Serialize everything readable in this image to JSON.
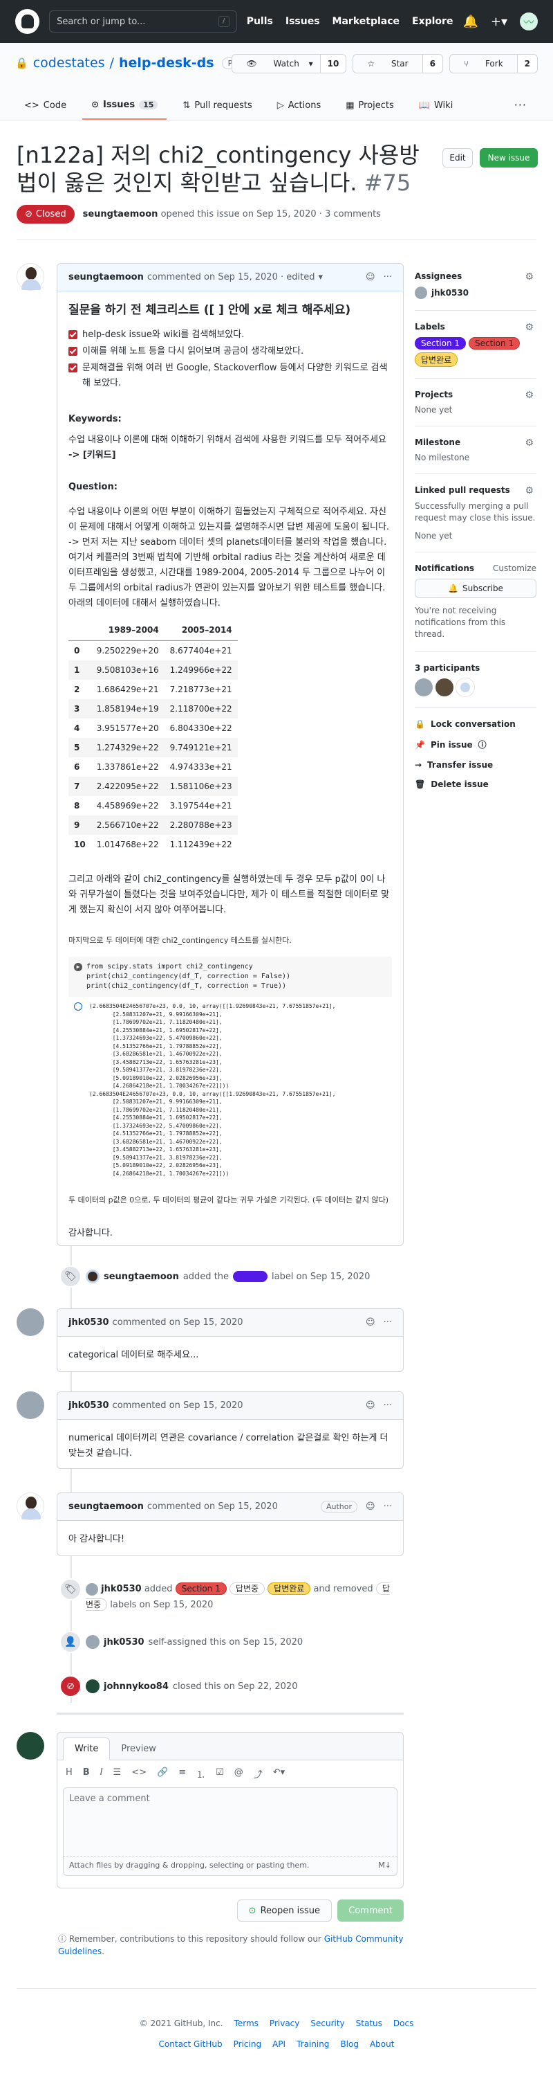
{
  "header": {
    "search_placeholder": "Search or jump to...",
    "slash": "/",
    "nav": [
      "Pulls",
      "Issues",
      "Marketplace",
      "Explore"
    ]
  },
  "repo": {
    "owner": "codestates",
    "name": "help-desk-ds",
    "visibility": "Private",
    "watch": "Watch",
    "watch_count": "10",
    "star": "Star",
    "star_count": "6",
    "fork": "Fork",
    "fork_count": "2"
  },
  "tabs": [
    {
      "label": "Code"
    },
    {
      "label": "Issues",
      "count": "15"
    },
    {
      "label": "Pull requests"
    },
    {
      "label": "Actions"
    },
    {
      "label": "Projects"
    },
    {
      "label": "Wiki"
    }
  ],
  "issue": {
    "title": "[n122a] 저의 chi2_contingency 사용방법이 옳은 것인지 확인받고 싶습니다.",
    "number": "#75",
    "edit": "Edit",
    "new_issue": "New issue",
    "state": "Closed",
    "author": "seungtaemoon",
    "meta": "opened this issue on Sep 15, 2020 · 3 comments"
  },
  "first_comment": {
    "author": "seungtaemoon",
    "meta": "commented on Sep 15, 2020 · edited",
    "heading": "질문을 하기 전 체크리스트 ([ ] 안에 x로 체크 해주세요)",
    "checks": [
      "help-desk issue와 wiki를 검색해보았다.",
      "이해를 위해 노트 등을 다시 읽어보며 공금이 생각해보았다.",
      "문제해결을 위해 여러 번 Google, Stackoverflow 등에서 다양한 키워드로 검색해 보았다."
    ],
    "kw_title": "Keywords:",
    "kw_text": "수업 내용이나 이론에 대해 이해하기 위해서 검색에 사용한 키워드를 모두 적어주세요",
    "kw_value": "-> [키워드]",
    "q_title": "Question:",
    "q_text": "수업 내용이나 이론의 어떤 부분이 이해하기 힘들었는지 구체적으로 적어주세요. 자신이 문제에 대해서 어떻게 이해하고 있는지를 설명해주시면 답변 제공에 도움이 됩니다. -> 먼저 저는 지난 seaborn 데이터 셋의 planets데이터를 불러와 작업을 했습니다. 여기서 케플러의 3번째 법칙에 기반해 orbital radius 라는 것을 계산하여 새로운 데이터프레임을 생성했고, 시간대를 1989-2004, 2005-2014 두 그룹으로 나누어 이 두 그룹에서의 orbital radius가 연관이 있는지를 알아보기 위한 테스트를 했습니다. 아래의 데이터에 대해서 실행하였습니다.",
    "table_cols": [
      "1989–2004",
      "2005–2014"
    ],
    "table_rows": [
      [
        "0",
        "9.250229e+20",
        "8.677404e+21"
      ],
      [
        "1",
        "9.508103e+16",
        "1.249966e+22"
      ],
      [
        "2",
        "1.686429e+21",
        "7.218773e+21"
      ],
      [
        "3",
        "1.858194e+19",
        "2.118700e+22"
      ],
      [
        "4",
        "3.951577e+20",
        "6.804330e+22"
      ],
      [
        "5",
        "1.274329e+22",
        "9.749121e+21"
      ],
      [
        "6",
        "1.337861e+22",
        "4.974333e+21"
      ],
      [
        "7",
        "2.422095e+22",
        "1.581106e+23"
      ],
      [
        "8",
        "4.458969e+22",
        "3.197544e+21"
      ],
      [
        "9",
        "2.566710e+22",
        "2.280788e+23"
      ],
      [
        "10",
        "1.014768e+22",
        "1.112439e+22"
      ]
    ],
    "after_table": "그리고 아래와 같이 chi2_contingency를 실행하였는데 두 경우 모두 p값이 0이 나와 귀무가설이 틀렸다는 것을 보여주었습니다만, 제가 이 테스트를 적절한 데이터로 맞게 했는지 확신이 서지 않아 여쭈어봅니다.",
    "small1": "마지막으로 두 데이터에 대한 chi2_contingency 테스트를 실시한다.",
    "code": [
      "from scipy.stats import chi2_contingency",
      "print(chi2_contingency(df_T, correction = False))",
      "print(chi2_contingency(df_T, correction = True))"
    ],
    "output": "(2.6683504E24656707e+23, 0.0, 10, array([[1.92690843e+21, 7.67551857e+21],\n       [2.50831207e+21, 9.99166309e+21],\n       [1.78699702e+21, 7.11820480e+21],\n       [4.25530884e+21, 1.69502817e+22],\n       [1.37324693e+22, 5.47009860e+22],\n       [4.51352766e+21, 1.79788852e+22],\n       [3.68286581e+21, 1.46700922e+22],\n       [3.45882713e+22, 1.65763281e+23],\n       [9.58941377e+21, 3.81978236e+22],\n       [5.09189010e+22, 2.02826956e+23],\n       [4.26864218e+21, 1.70034267e+22]]))\n(2.6683504E24656707e+23, 0.0, 10, array([[1.92690843e+21, 7.67551857e+21],\n       [2.50831207e+21, 9.99166309e+21],\n       [1.78699702e+21, 7.11820480e+21],\n       [4.25530884e+21, 1.69502817e+22],\n       [1.37324693e+22, 5.47009860e+22],\n       [4.51352766e+21, 1.79788852e+22],\n       [3.68286581e+21, 1.46700922e+22],\n       [3.45882713e+22, 1.65763281e+23],\n       [9.58941377e+21, 3.81978236e+22],\n       [5.09189010e+22, 2.02826956e+23],\n       [4.26864218e+21, 1.70034267e+22]]))",
    "small2": "두 데이터의 p값은 0으로, 두 데이터의 평균이 같다는 귀무 가설은 기각된다. (두 데이터는 같지 않다)",
    "thanks": "감사합니다."
  },
  "event1": {
    "user": "seungtaemoon",
    "pre": "added the",
    "post": "label on Sep 15, 2020"
  },
  "comment2": {
    "author": "jhk0530",
    "meta": "commented on Sep 15, 2020",
    "body": "categorical 데이터로 해주세요..."
  },
  "comment3": {
    "author": "jhk0530",
    "meta": "commented on Sep 15, 2020",
    "body": "numerical 데이터끼리 연관은 covariance / correlation 같은걸로 확인 하는게 더 맞는것 같습니다."
  },
  "comment4": {
    "author": "seungtaemoon",
    "meta": "commented on Sep 15, 2020",
    "badge": "Author",
    "body": "아 감사합니다!"
  },
  "event2": {
    "user": "jhk0530",
    "pre": "added",
    "labels": [
      "Section 1",
      "답변중",
      "답변완료"
    ],
    "mid": "and removed",
    "removed": "답변중",
    "post": "labels on Sep 15, 2020"
  },
  "event3": {
    "user": "jhk0530",
    "text": "self-assigned this on Sep 15, 2020"
  },
  "event4": {
    "user": "johnnykoo84",
    "text": "closed this on Sep 22, 2020"
  },
  "sidebar": {
    "assignees_t": "Assignees",
    "assignee": "jhk0530",
    "labels_t": "Labels",
    "labels": [
      "Section 1",
      "답변완료"
    ],
    "projects_t": "Projects",
    "projects_v": "None yet",
    "milestone_t": "Milestone",
    "milestone_v": "No milestone",
    "linked_t": "Linked pull requests",
    "linked_d": "Successfully merging a pull request may close this issue.",
    "linked_v": "None yet",
    "notif_t": "Notifications",
    "customize": "Customize",
    "subscribe": "Subscribe",
    "notif_d": "You're not receiving notifications from this thread.",
    "participants": "3 participants",
    "lock": "Lock conversation",
    "pin": "Pin issue",
    "transfer": "Transfer issue",
    "delete": "Delete issue"
  },
  "new_comment": {
    "write": "Write",
    "preview": "Preview",
    "placeholder": "Leave a comment",
    "attach": "Attach files by dragging & dropping, selecting or pasting them.",
    "reopen": "Reopen issue",
    "submit": "Comment",
    "tip_pre": "Remember, contributions to this repository should follow our",
    "tip_link": "GitHub Community Guidelines",
    "tip_post": "."
  },
  "footer": {
    "copy": "© 2021 GitHub, Inc.",
    "row1": [
      "Terms",
      "Privacy",
      "Security",
      "Status",
      "Docs"
    ],
    "row2": [
      "Contact GitHub",
      "Pricing",
      "API",
      "Training",
      "Blog",
      "About"
    ]
  },
  "colors": {
    "header": "#24292e",
    "closed": "#cb2431",
    "green": "#2ea44f",
    "accent": "#f9826c",
    "link": "#0366d6"
  }
}
